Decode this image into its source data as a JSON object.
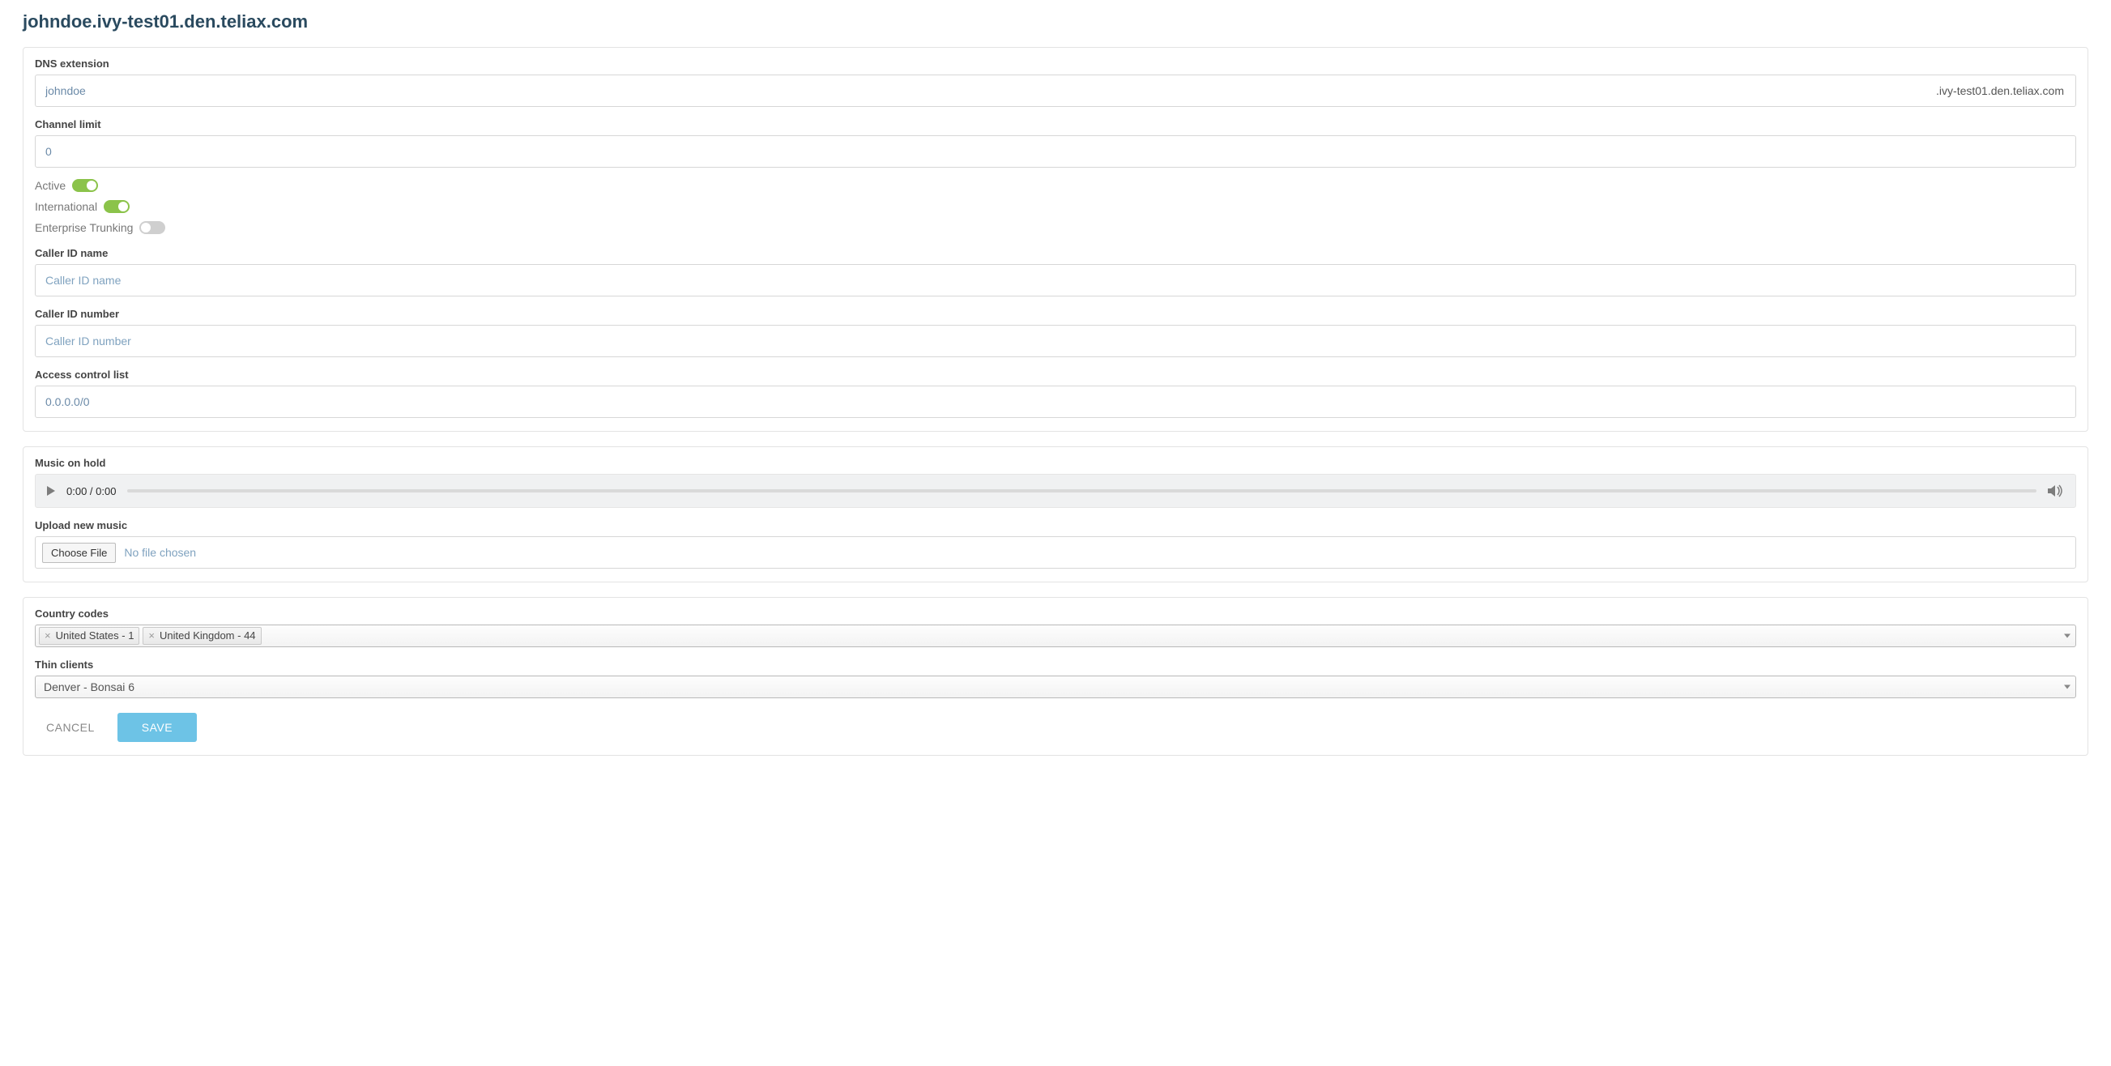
{
  "page_title": "johndoe.ivy-test01.den.teliax.com",
  "panel1": {
    "dns_extension": {
      "label": "DNS extension",
      "value": "johndoe",
      "suffix": ".ivy-test01.den.teliax.com"
    },
    "channel_limit": {
      "label": "Channel limit",
      "value": "0"
    },
    "toggles": {
      "active": {
        "label": "Active",
        "on": true
      },
      "international": {
        "label": "International",
        "on": true
      },
      "enterprise": {
        "label": "Enterprise Trunking",
        "on": false
      }
    },
    "caller_id_name": {
      "label": "Caller ID name",
      "placeholder": "Caller ID name",
      "value": ""
    },
    "caller_id_number": {
      "label": "Caller ID number",
      "placeholder": "Caller ID number",
      "value": ""
    },
    "acl": {
      "label": "Access control list",
      "value": "0.0.0.0/0"
    }
  },
  "panel2": {
    "music_label": "Music on hold",
    "audio_time": "0:00 / 0:00",
    "upload_label": "Upload new music",
    "choose_file_btn": "Choose File",
    "file_status": "No file chosen"
  },
  "panel3": {
    "country_codes_label": "Country codes",
    "country_codes": [
      "United States - 1",
      "United Kingdom - 44"
    ],
    "thin_clients_label": "Thin clients",
    "thin_client_selected": "Denver - Bonsai 6"
  },
  "buttons": {
    "cancel": "CANCEL",
    "save": "SAVE"
  }
}
